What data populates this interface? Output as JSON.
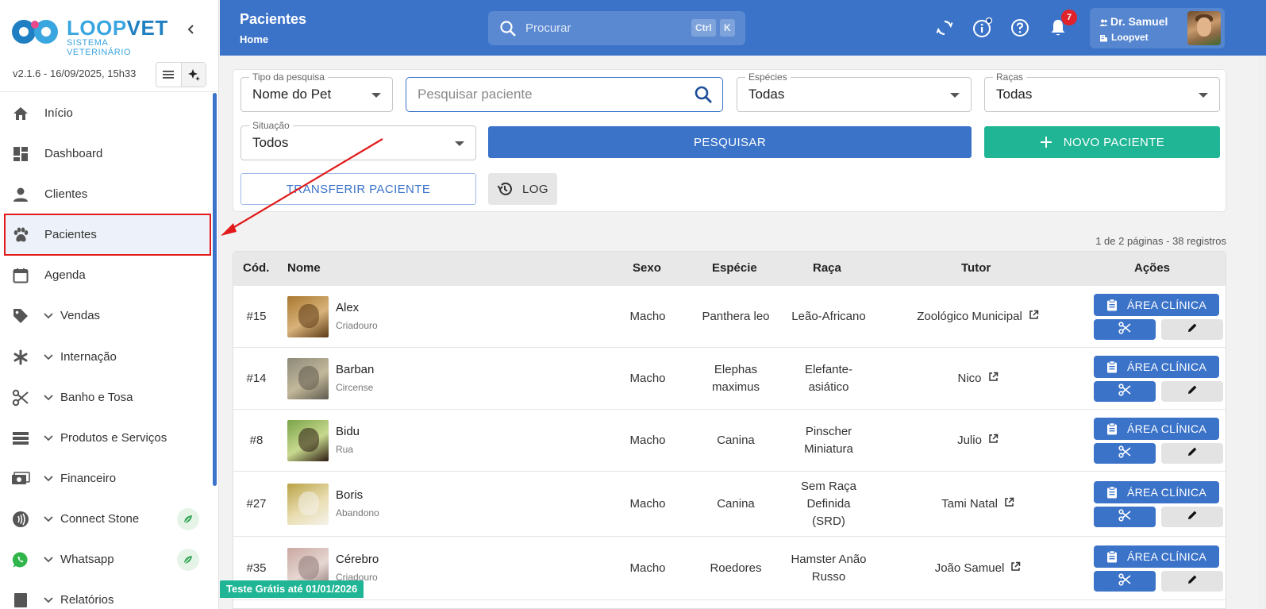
{
  "sidebar": {
    "logo_text_a": "LOOP",
    "logo_text_b": "VET",
    "logo_subtitle": "SISTEMA VETERINÁRIO",
    "version": "v2.1.6 - 16/09/2025, 15h33",
    "items": [
      {
        "label": "Início",
        "icon": "home-icon"
      },
      {
        "label": "Dashboard",
        "icon": "dashboard-icon"
      },
      {
        "label": "Clientes",
        "icon": "person-icon"
      },
      {
        "label": "Pacientes",
        "icon": "paw-icon",
        "active": true
      },
      {
        "label": "Agenda",
        "icon": "calendar-icon"
      },
      {
        "label": "Vendas",
        "icon": "tag-icon",
        "expandable": true
      },
      {
        "label": "Internação",
        "icon": "asterisk-icon",
        "expandable": true
      },
      {
        "label": "Banho e Tosa",
        "icon": "scissors-icon",
        "expandable": true
      },
      {
        "label": "Produtos e Serviços",
        "icon": "list-icon",
        "expandable": true
      },
      {
        "label": "Financeiro",
        "icon": "money-icon",
        "expandable": true
      },
      {
        "label": "Connect Stone",
        "icon": "contactless-icon",
        "expandable": true,
        "badge": "leaf-icon"
      },
      {
        "label": "Whatsapp",
        "icon": "whatsapp-icon",
        "expandable": true,
        "badge": "leaf-icon"
      },
      {
        "label": "Relatórios",
        "icon": "report-icon",
        "expandable": true
      }
    ]
  },
  "header": {
    "title": "Pacientes",
    "breadcrumb": "Home",
    "search_placeholder": "Procurar",
    "shortcut_ctrl": "Ctrl",
    "shortcut_key": "K",
    "notification_count": "7",
    "user_name": "Dr. Samuel",
    "user_org": "Loopvet"
  },
  "filters": {
    "tipo_label": "Tipo da pesquisa",
    "tipo_value": "Nome do Pet",
    "search_placeholder": "Pesquisar paciente",
    "especies_label": "Espécies",
    "especies_value": "Todas",
    "racas_label": "Raças",
    "racas_value": "Todas",
    "situacao_label": "Situação",
    "situacao_value": "Todos",
    "pesquisar_label": "PESQUISAR",
    "novo_label": "NOVO PACIENTE",
    "transferir_label": "TRANSFERIR PACIENTE",
    "log_label": "LOG"
  },
  "pagination": {
    "info": "1 de 2 páginas - 38 registros"
  },
  "table": {
    "columns": {
      "cod": "Cód.",
      "nome": "Nome",
      "sexo": "Sexo",
      "especie": "Espécie",
      "raca": "Raça",
      "tutor": "Tutor",
      "acoes": "Ações"
    },
    "action_clinica": "ÁREA CLÍNICA",
    "rows": [
      {
        "cod": "#15",
        "nome": "Alex",
        "origem": "Criadouro",
        "sexo": "Macho",
        "especie_1": "Panthera leo",
        "especie_2": "",
        "raca_1": "Leão-Africano",
        "raca_2": "",
        "raca_3": "",
        "tutor": "Zoológico Municipal",
        "thumb_colors": [
          "#a9782f",
          "#d8b27a",
          "#5c3b15"
        ]
      },
      {
        "cod": "#14",
        "nome": "Barban",
        "origem": "Circense",
        "sexo": "Macho",
        "especie_1": "Elephas",
        "especie_2": "maximus",
        "raca_1": "Elefante-",
        "raca_2": "asiático",
        "raca_3": "",
        "tutor": "Nico",
        "thumb_colors": [
          "#8d8a7a",
          "#c2b79a",
          "#5e5a4d"
        ]
      },
      {
        "cod": "#8",
        "nome": "Bidu",
        "origem": "Rua",
        "sexo": "Macho",
        "especie_1": "Canina",
        "especie_2": "",
        "raca_1": "Pinscher",
        "raca_2": "Miniatura",
        "raca_3": "",
        "tutor": "Julio",
        "thumb_colors": [
          "#7aa34a",
          "#c8d98e",
          "#2b1a10"
        ]
      },
      {
        "cod": "#27",
        "nome": "Boris",
        "origem": "Abandono",
        "sexo": "Macho",
        "especie_1": "Canina",
        "especie_2": "",
        "raca_1": "Sem Raça",
        "raca_2": "Definida",
        "raca_3": "(SRD)",
        "tutor": "Tami Natal",
        "thumb_colors": [
          "#b8a246",
          "#e9ddb0",
          "#f4f1ea"
        ]
      },
      {
        "cod": "#35",
        "nome": "Cérebro",
        "origem": "Criadouro",
        "sexo": "Macho",
        "especie_1": "Roedores",
        "especie_2": "",
        "raca_1": "Hamster Anão",
        "raca_2": "Russo",
        "raca_3": "",
        "tutor": "João Samuel",
        "thumb_colors": [
          "#c9a8a0",
          "#e6d6d2",
          "#8f7a78"
        ]
      }
    ]
  },
  "trial": "Teste Grátis até 01/01/2026",
  "colors": {
    "primary": "#3b73c9",
    "teal": "#1fb595",
    "alert": "#e21a1a"
  }
}
